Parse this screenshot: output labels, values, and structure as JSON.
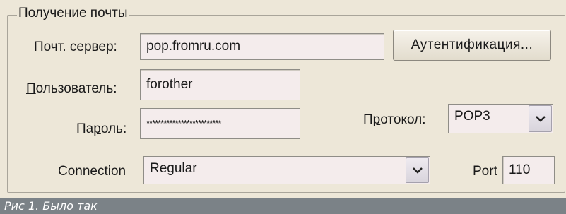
{
  "group": {
    "title": "Получение почты"
  },
  "server": {
    "label_pre": "Поч",
    "label_key": "т",
    "label_post": ". сервер:",
    "value": "pop.fromru.com"
  },
  "auth_button": {
    "label": "Аутентификация..."
  },
  "user": {
    "label_key": "П",
    "label_post": "ользователь:",
    "value": "forother"
  },
  "password": {
    "label_pre": "Па",
    "label_key": "р",
    "label_post": "оль:",
    "value": "**************************"
  },
  "protocol": {
    "label_pre": "П",
    "label_key": "р",
    "label_post": "отокол:",
    "selected": "POP3"
  },
  "connection": {
    "label": "Connection",
    "selected": "Regular"
  },
  "port": {
    "label": "Port",
    "value": "110"
  },
  "caption": "Рис 1. Было так",
  "icons": {
    "dropdown": "chevron-down-icon"
  },
  "colors": {
    "caption_bar": "#7b8287",
    "field_bg": "#f4ecec",
    "window_bg": "#ede7d8"
  }
}
